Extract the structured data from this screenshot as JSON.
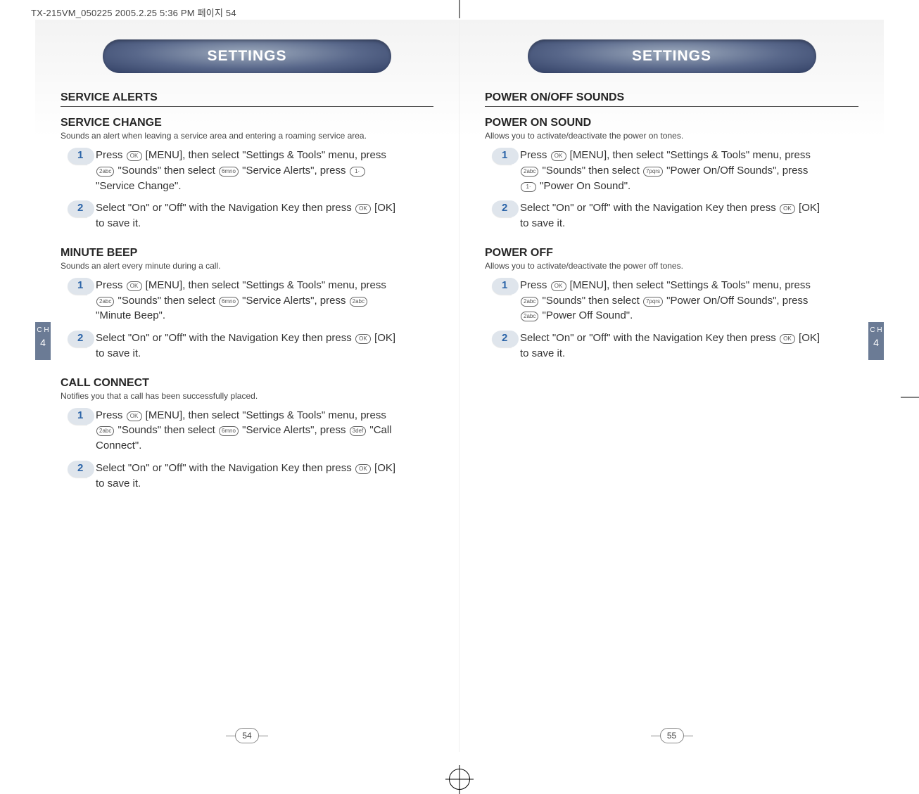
{
  "slug": "TX-215VM_050225  2005.2.25 5:36 PM  페이지 54",
  "header_title": "SETTINGS",
  "chapter_tab": {
    "label": "C\nH",
    "number": "4"
  },
  "left": {
    "page_number": "54",
    "section_title": "SERVICE ALERTS",
    "blocks": [
      {
        "subhead": "SERVICE CHANGE",
        "desc": "Sounds an alert when leaving a service area and entering a roaming service area.",
        "steps": [
          {
            "n": "1",
            "parts": [
              "Press ",
              {
                "key": "OK"
              },
              " [MENU], then select \"Settings & Tools\" menu, press ",
              {
                "key": "2abc"
              },
              " \"Sounds\" then select ",
              {
                "key": "6mno"
              },
              " \"Service Alerts\", press ",
              {
                "key": "1·"
              },
              " \"Service Change\"."
            ]
          },
          {
            "n": "2",
            "parts": [
              "Select \"On\" or \"Off\" with the Navigation Key then press ",
              {
                "key": "OK"
              },
              " [OK] to save it."
            ]
          }
        ]
      },
      {
        "subhead": "MINUTE BEEP",
        "desc": "Sounds an alert every minute during a call.",
        "steps": [
          {
            "n": "1",
            "parts": [
              "Press ",
              {
                "key": "OK"
              },
              " [MENU], then select \"Settings & Tools\" menu, press ",
              {
                "key": "2abc"
              },
              " \"Sounds\" then select ",
              {
                "key": "6mno"
              },
              " \"Service Alerts\", press ",
              {
                "key": "2abc"
              },
              " \"Minute Beep\"."
            ]
          },
          {
            "n": "2",
            "parts": [
              "Select \"On\" or \"Off\" with the Navigation Key then press ",
              {
                "key": "OK"
              },
              " [OK] to save it."
            ]
          }
        ]
      },
      {
        "subhead": "CALL CONNECT",
        "desc": "Notifies you that a call has been successfully placed.",
        "steps": [
          {
            "n": "1",
            "parts": [
              "Press ",
              {
                "key": "OK"
              },
              " [MENU], then select \"Settings & Tools\" menu, press ",
              {
                "key": "2abc"
              },
              " \"Sounds\" then select ",
              {
                "key": "6mno"
              },
              " \"Service Alerts\", press ",
              {
                "key": "3def"
              },
              " \"Call Connect\"."
            ]
          },
          {
            "n": "2",
            "parts": [
              "Select \"On\" or \"Off\" with the Navigation Key then press ",
              {
                "key": "OK"
              },
              " [OK] to save it."
            ]
          }
        ]
      }
    ]
  },
  "right": {
    "page_number": "55",
    "section_title": "POWER ON/OFF SOUNDS",
    "blocks": [
      {
        "subhead": "POWER ON SOUND",
        "desc": "Allows you to activate/deactivate the power on tones.",
        "steps": [
          {
            "n": "1",
            "parts": [
              "Press ",
              {
                "key": "OK"
              },
              " [MENU], then select \"Settings & Tools\" menu, press ",
              {
                "key": "2abc"
              },
              " \"Sounds\" then select ",
              {
                "key": "7pqrs"
              },
              " \"Power On/Off Sounds\", press ",
              {
                "key": "1·"
              },
              " \"Power On Sound\"."
            ]
          },
          {
            "n": "2",
            "parts": [
              "Select \"On\" or \"Off\" with the Navigation Key then press ",
              {
                "key": "OK"
              },
              " [OK] to save it."
            ]
          }
        ]
      },
      {
        "subhead": "POWER OFF",
        "desc": "Allows you to activate/deactivate the power off tones.",
        "steps": [
          {
            "n": "1",
            "parts": [
              "Press ",
              {
                "key": "OK"
              },
              " [MENU], then select \"Settings & Tools\" menu, press ",
              {
                "key": "2abc"
              },
              " \"Sounds\" then select ",
              {
                "key": "7pqrs"
              },
              " \"Power On/Off Sounds\", press ",
              {
                "key": "2abc"
              },
              " \"Power Off Sound\"."
            ]
          },
          {
            "n": "2",
            "parts": [
              "Select \"On\" or \"Off\" with the Navigation Key then press ",
              {
                "key": "OK"
              },
              " [OK] to save it."
            ]
          }
        ]
      }
    ]
  }
}
